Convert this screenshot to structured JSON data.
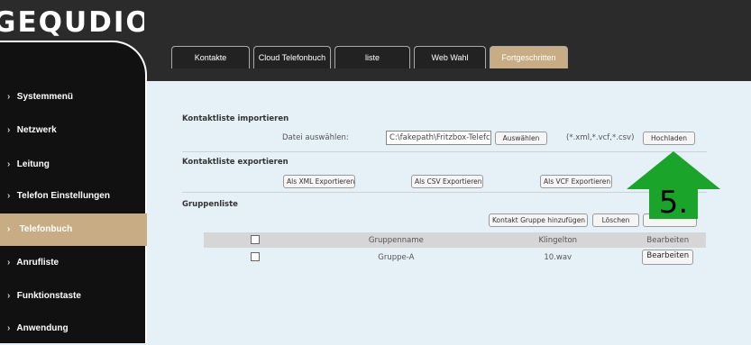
{
  "brand": {
    "logo_text": "GEQUDIO"
  },
  "sidebar": {
    "items": [
      {
        "label": "Systemmenü"
      },
      {
        "label": "Netzwerk"
      },
      {
        "label": "Leitung"
      },
      {
        "label": "Telefon Einstellungen"
      },
      {
        "label": "Telefonbuch",
        "active": true
      },
      {
        "label": "Anrufliste"
      },
      {
        "label": "Funktionstaste"
      },
      {
        "label": "Anwendung"
      }
    ]
  },
  "tabs": [
    {
      "label": "Kontakte"
    },
    {
      "label": "Cloud Telefonbuch"
    },
    {
      "label": "liste"
    },
    {
      "label": "Web Wahl"
    },
    {
      "label": "Fortgeschritten",
      "active": true
    }
  ],
  "import": {
    "title": "Kontaktliste importieren",
    "file_label": "Datei auswählen:",
    "file_value": "C:\\fakepath\\Fritzbox-Telefc",
    "choose_btn": "Auswählen",
    "formats": "(*.xml,*.vcf,*.csv)",
    "upload_btn": "Hochladen"
  },
  "export": {
    "title": "Kontaktliste exportieren",
    "xml_btn": "Als XML Exportieren",
    "csv_btn": "Als CSV Exportieren",
    "vcf_btn": "Als VCF Exportieren"
  },
  "groups": {
    "title": "Gruppenliste",
    "add_btn": "Kontakt Gruppe hinzufügen",
    "delete_btn": "Löschen",
    "columns": [
      "",
      "Gruppenname",
      "Klingelton",
      "Bearbeiten"
    ],
    "rows": [
      {
        "name": "Gruppe-A",
        "ringtone": "10.wav",
        "edit_label": "Bearbeiten"
      }
    ]
  },
  "annotation": {
    "label": "5.",
    "color": "#1aa52a"
  },
  "colors": {
    "accent": "#c8ad84",
    "dark": "#111111",
    "content_bg": "#e6f0f7"
  }
}
